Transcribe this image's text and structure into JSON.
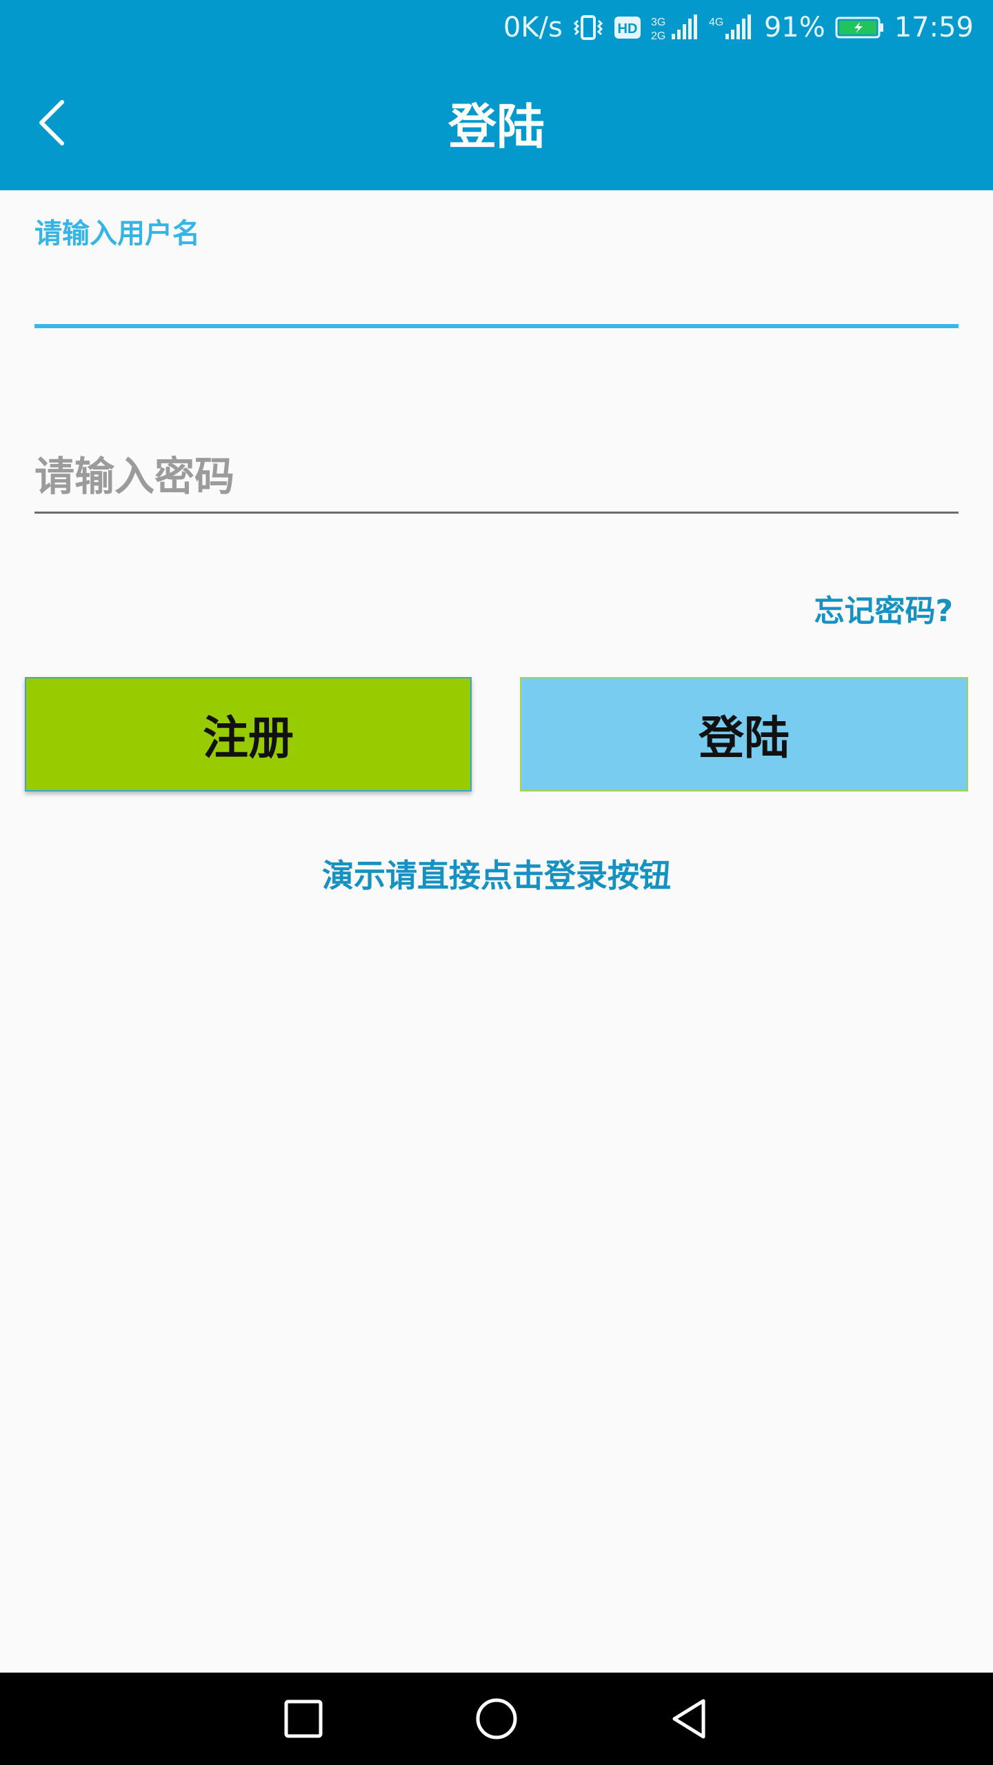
{
  "status_bar": {
    "net_speed": "0K/s",
    "hd_badge": "HD",
    "net_type_top": "3G",
    "net_type_bottom": "2G",
    "net_type_2": "4G",
    "battery_percent": "91%",
    "time": "17:59",
    "icons": [
      "vibrate-icon",
      "hd-icon",
      "signal-icon",
      "signal-icon",
      "battery-charging-icon"
    ]
  },
  "app_bar": {
    "title": "登陆",
    "back_icon": "chevron-left-icon"
  },
  "form": {
    "username_label": "请输入用户名",
    "username_value": "",
    "password_placeholder": "请输入密码",
    "password_value": "",
    "forgot_password": "忘记密码?"
  },
  "buttons": {
    "register": "注册",
    "login": "登陆"
  },
  "hint": "演示请直接点击登录按钮",
  "nav_bar": {
    "icons": [
      "recents-square-icon",
      "home-circle-icon",
      "back-triangle-icon"
    ]
  },
  "colors": {
    "primary": "#0399cc",
    "accent": "#38b6e8",
    "register_button": "#99cc00",
    "login_button": "#78ccef",
    "link": "#1591c2"
  }
}
